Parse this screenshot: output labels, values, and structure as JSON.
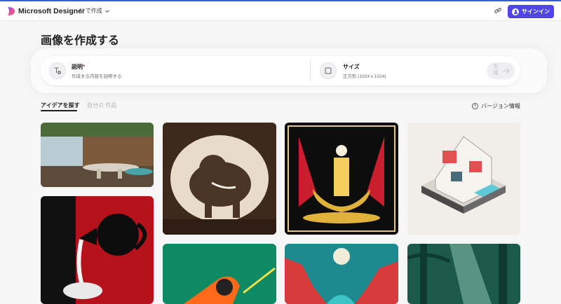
{
  "header": {
    "brand": "Microsoft Designer",
    "ai_menu_label": "AI で作成",
    "signin_label": "サインイン"
  },
  "main": {
    "title": "画像を作成する",
    "prompt": {
      "description": {
        "label": "説明",
        "required_mark": "*",
        "placeholder": "作成する内容を説明する"
      },
      "size": {
        "label": "サイズ",
        "value": "正方形 (1024 x 1024)"
      },
      "generate_label": "生成"
    },
    "tabs": [
      {
        "label": "アイデアを探す",
        "active": true
      },
      {
        "label": "自分の 作品",
        "active": false
      }
    ],
    "version_info_label": "バージョン情報"
  },
  "gallery": [
    {
      "name": "restaurant-interior"
    },
    {
      "name": "elephant-woodcut"
    },
    {
      "name": "art-deco-fountain"
    },
    {
      "name": "isometric-house"
    },
    {
      "name": "milk-pour"
    },
    {
      "name": "orange-poster"
    },
    {
      "name": "red-canyon"
    },
    {
      "name": "jungle-rays"
    }
  ],
  "colors": {
    "accent": "#4f46e5",
    "top_line": "#3b5bdb",
    "background": "#f6f6f7"
  }
}
